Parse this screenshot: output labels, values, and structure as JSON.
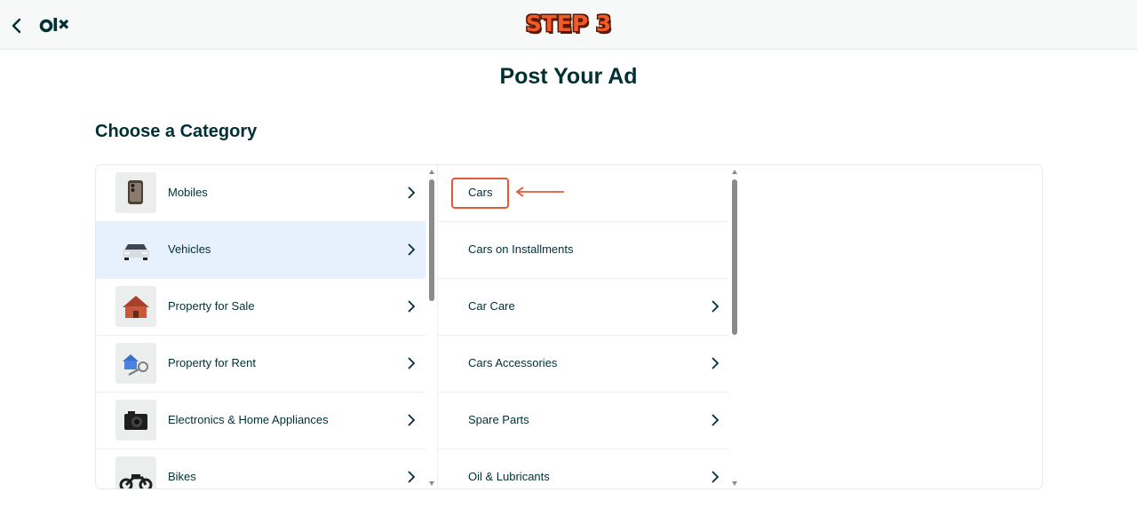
{
  "header": {
    "step_label": "STEP 3",
    "logo_text": "olx"
  },
  "page_title": "Post Your Ad",
  "section_title": "Choose a Category",
  "categories": [
    {
      "label": "Mobiles",
      "icon": "phone-icon",
      "selected": false
    },
    {
      "label": "Vehicles",
      "icon": "car-icon",
      "selected": true
    },
    {
      "label": "Property for Sale",
      "icon": "house-icon",
      "selected": false
    },
    {
      "label": "Property for Rent",
      "icon": "house-key-icon",
      "selected": false
    },
    {
      "label": "Electronics & Home Appliances",
      "icon": "camera-icon",
      "selected": false
    },
    {
      "label": "Bikes",
      "icon": "motorbike-icon",
      "selected": false
    }
  ],
  "subcategories": [
    {
      "label": "Cars",
      "has_children": false,
      "highlighted": true
    },
    {
      "label": "Cars on Installments",
      "has_children": false
    },
    {
      "label": "Car Care",
      "has_children": true
    },
    {
      "label": "Cars Accessories",
      "has_children": true
    },
    {
      "label": "Spare Parts",
      "has_children": true
    },
    {
      "label": "Oil & Lubricants",
      "has_children": true
    }
  ],
  "colors": {
    "highlight": "#e05a38",
    "selected_row": "#e7f0fd",
    "text": "#002f34",
    "step_label": "#f05a28"
  }
}
